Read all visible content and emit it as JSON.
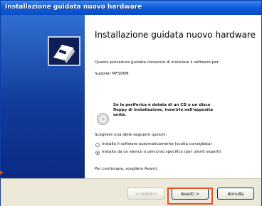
{
  "window": {
    "title": "Installazione guidata nuovo hardware"
  },
  "wizard": {
    "heading": "Installazione guidata nuovo hardware",
    "intro": "Questa procedura guidata consente di installare il software per:",
    "device": "Supplier MFS0KM",
    "cd_note_line1": "Se la periferica è dotata di un CD o un disco",
    "cd_note_line2": "floppy di installazione, inserirlo nell'apposita",
    "cd_note_line3": "unità.",
    "choose_prompt": "Scegliere una delle seguenti opzioni:",
    "options": [
      {
        "label": "Installa il software automaticamente (scelta consigliata)",
        "selected": false
      },
      {
        "label": "Installa da un elenco o percorso specifico (per utenti esperti)",
        "selected": true
      }
    ],
    "continue_prompt": "Per continuare, scegliere Avanti."
  },
  "buttons": {
    "back": "< Indietro",
    "next": "Avanti >",
    "cancel": "Annulla"
  },
  "colors": {
    "highlight": "#e8531c",
    "titlebar": "#0e5ddb",
    "sidepanel": "#123a9a"
  }
}
